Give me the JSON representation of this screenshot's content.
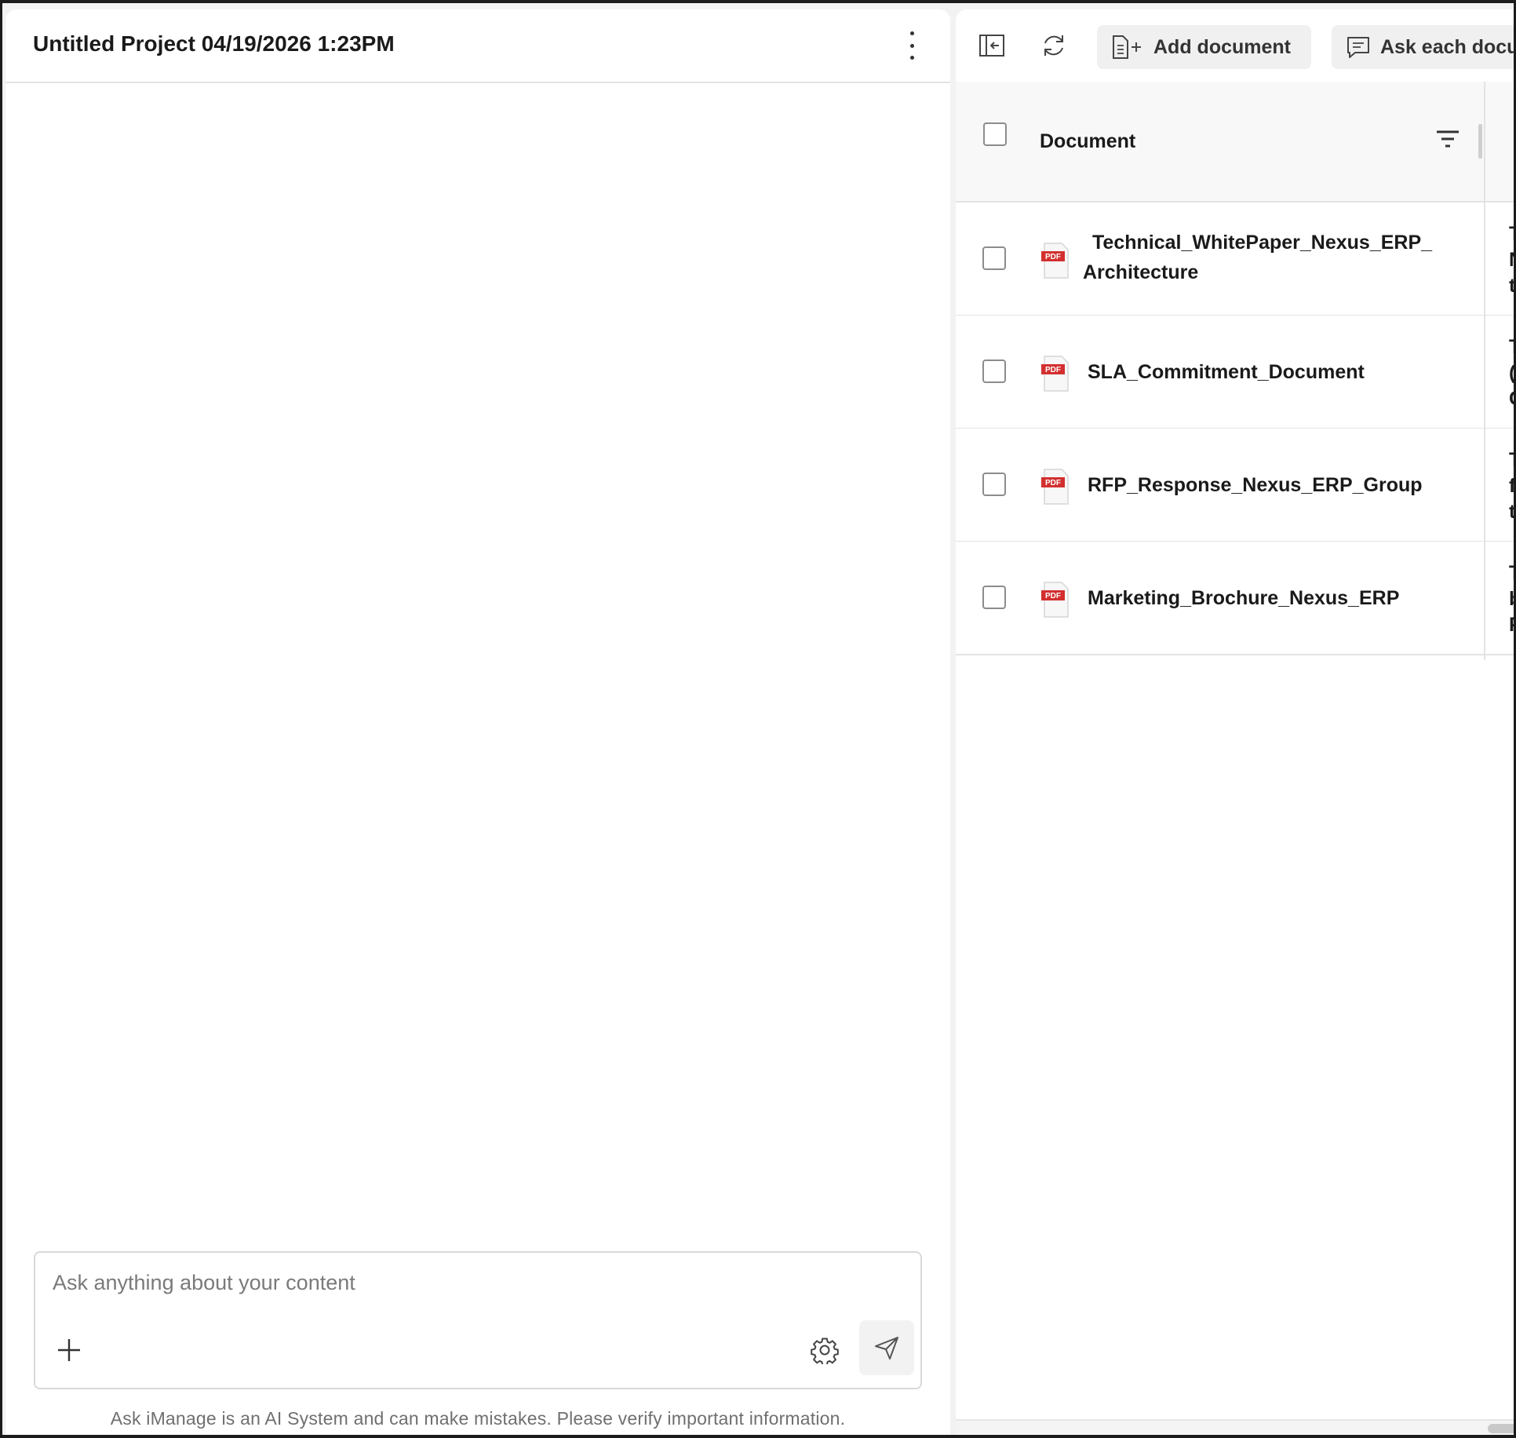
{
  "chat": {
    "title": "Untitled Project 04/19/2026 1:23PM",
    "input_placeholder": "Ask anything about your content",
    "disclaimer": "Ask iManage is an AI System and can make mistakes. Please verify important information."
  },
  "toolbar": {
    "add_document_label": "Add document",
    "ask_each_label": "Ask each docu"
  },
  "table": {
    "column_header": "Document",
    "rows": [
      {
        "name_line1": "Technical_WhitePaper_Nexus_ERP_",
        "name_line2": "Architecture",
        "preview": [
          "T",
          "N",
          "t"
        ]
      },
      {
        "name": "SLA_Commitment_Document",
        "preview": [
          "T",
          "(",
          "C"
        ]
      },
      {
        "name": "RFP_Response_Nexus_ERP_Group",
        "preview": [
          "T",
          "f",
          "t"
        ]
      },
      {
        "name": "Marketing_Brochure_Nexus_ERP",
        "preview": [
          "T",
          "b",
          "P"
        ]
      }
    ]
  },
  "icons": {
    "pdf_badge": "PDF"
  },
  "colors": {
    "pdf_red": "#d32f2f",
    "border": "#e3e3e3",
    "button_bg": "#f0f0f0"
  }
}
